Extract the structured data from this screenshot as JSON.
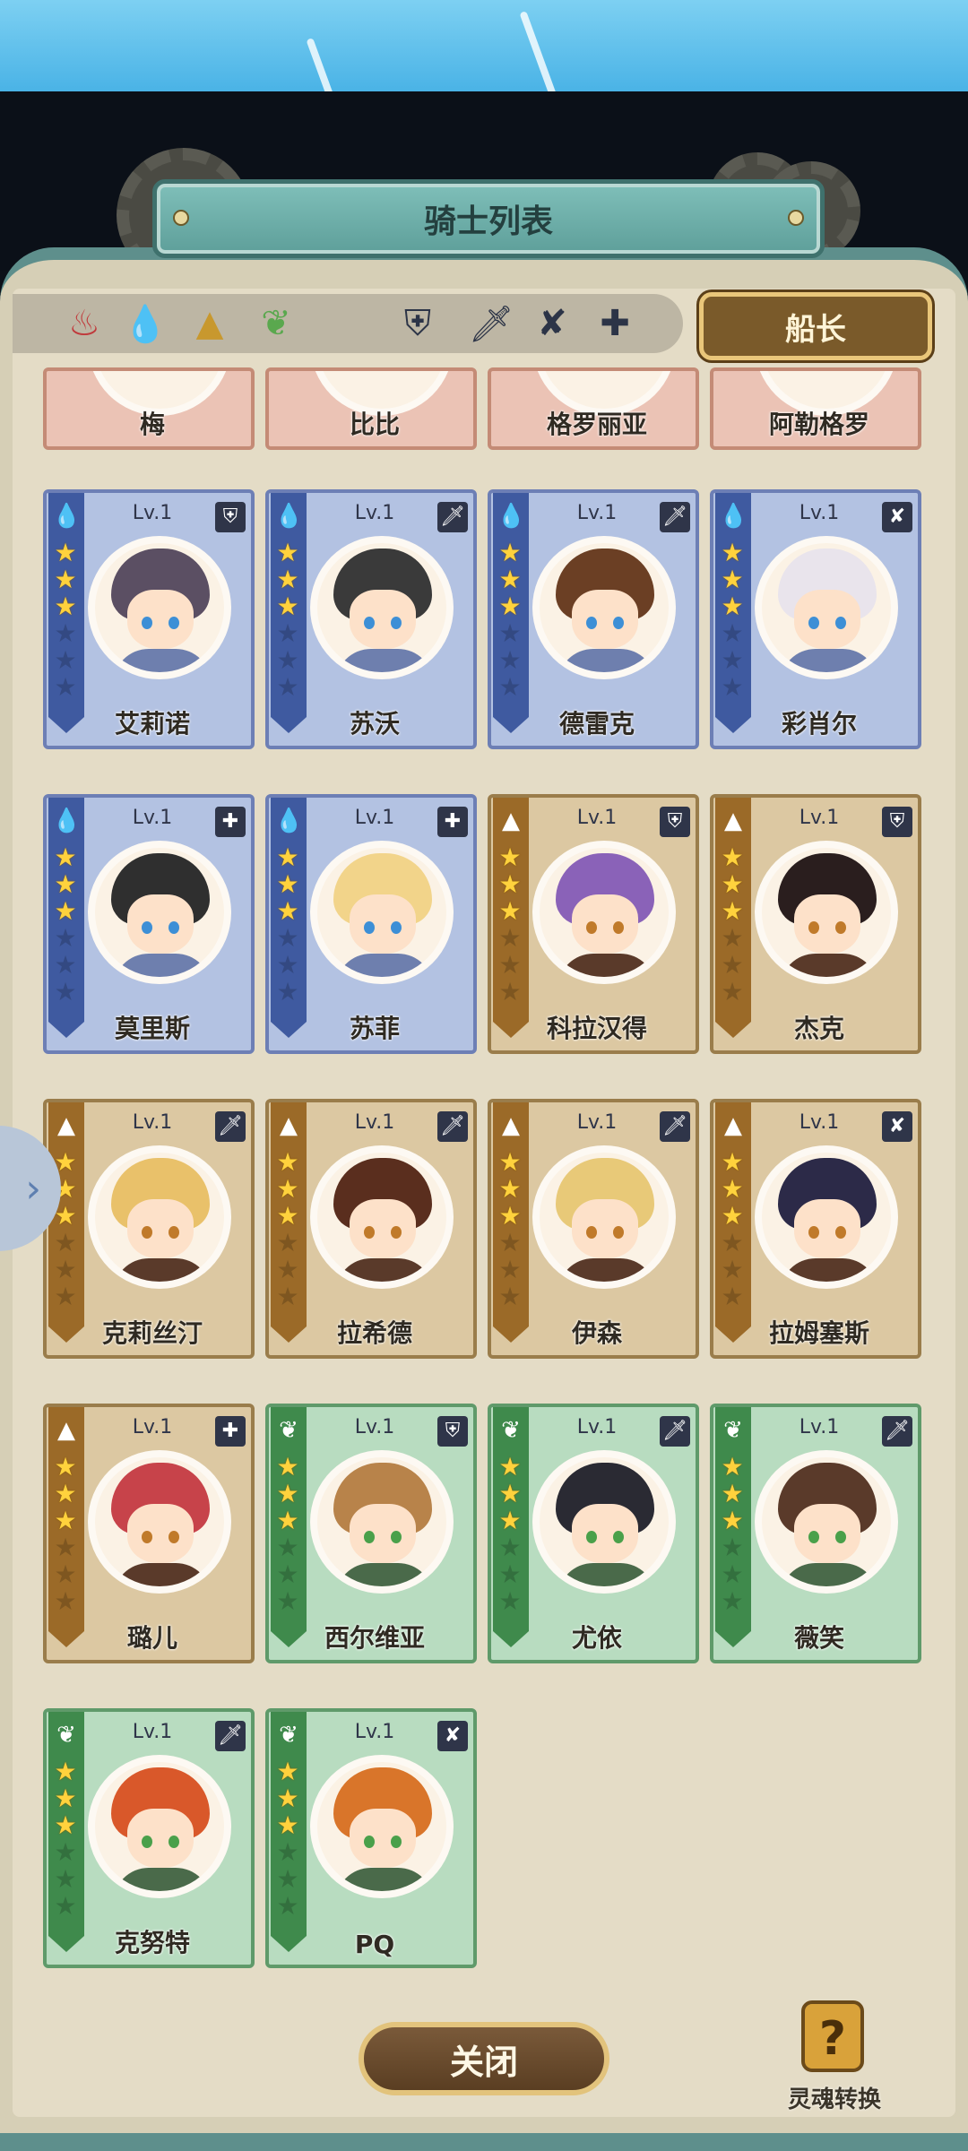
{
  "title": "骑士列表",
  "captain_label": "船长",
  "close_label": "关闭",
  "soul_label": "灵魂转换",
  "soul_icon_glyph": "?",
  "side_arrow_glyph": "›",
  "filters": {
    "elements": [
      {
        "name": "fire",
        "glyph": "♨"
      },
      {
        "name": "water",
        "glyph": "💧"
      },
      {
        "name": "earth",
        "glyph": "▲"
      },
      {
        "name": "wind",
        "glyph": "❦"
      }
    ],
    "classes": [
      {
        "name": "shield",
        "glyph": "⛨"
      },
      {
        "name": "sword",
        "glyph": "🗡"
      },
      {
        "name": "bow",
        "glyph": "✘"
      },
      {
        "name": "cross",
        "glyph": "✚"
      }
    ]
  },
  "partial_row": [
    {
      "name": "梅"
    },
    {
      "name": "比比"
    },
    {
      "name": "格罗丽亚"
    },
    {
      "name": "阿勒格罗"
    }
  ],
  "knights": [
    {
      "name": "艾莉诺",
      "level": "Lv.1",
      "element": "water",
      "class": "shield",
      "stars": 3
    },
    {
      "name": "苏沃",
      "level": "Lv.1",
      "element": "water",
      "class": "sword",
      "stars": 3
    },
    {
      "name": "德雷克",
      "level": "Lv.1",
      "element": "water",
      "class": "sword",
      "stars": 3
    },
    {
      "name": "彩肖尔",
      "level": "Lv.1",
      "element": "water",
      "class": "bow",
      "stars": 3
    },
    {
      "name": "莫里斯",
      "level": "Lv.1",
      "element": "water",
      "class": "cross",
      "stars": 3
    },
    {
      "name": "苏菲",
      "level": "Lv.1",
      "element": "water",
      "class": "cross",
      "stars": 3
    },
    {
      "name": "科拉汉得",
      "level": "Lv.1",
      "element": "earth",
      "class": "shield",
      "stars": 3
    },
    {
      "name": "杰克",
      "level": "Lv.1",
      "element": "earth",
      "class": "shield",
      "stars": 3
    },
    {
      "name": "克莉丝汀",
      "level": "Lv.1",
      "element": "earth",
      "class": "sword",
      "stars": 3
    },
    {
      "name": "拉希德",
      "level": "Lv.1",
      "element": "earth",
      "class": "sword",
      "stars": 3
    },
    {
      "name": "伊森",
      "level": "Lv.1",
      "element": "earth",
      "class": "sword",
      "stars": 3
    },
    {
      "name": "拉姆塞斯",
      "level": "Lv.1",
      "element": "earth",
      "class": "bow",
      "stars": 3
    },
    {
      "name": "璐儿",
      "level": "Lv.1",
      "element": "earth",
      "class": "cross",
      "stars": 3
    },
    {
      "name": "西尔维亚",
      "level": "Lv.1",
      "element": "wind",
      "class": "shield",
      "stars": 3
    },
    {
      "name": "尤依",
      "level": "Lv.1",
      "element": "wind",
      "class": "sword",
      "stars": 3
    },
    {
      "name": "薇笑",
      "level": "Lv.1",
      "element": "wind",
      "class": "sword",
      "stars": 3
    },
    {
      "name": "克努特",
      "level": "Lv.1",
      "element": "wind",
      "class": "sword",
      "stars": 3
    },
    {
      "name": "PQ",
      "level": "Lv.1",
      "element": "wind",
      "class": "bow",
      "stars": 3
    }
  ],
  "element_glyphs": {
    "water": "💧",
    "earth": "▲",
    "wind": "❦",
    "fire": "♨"
  },
  "class_glyphs": {
    "shield": "⛨",
    "sword": "🗡",
    "bow": "✘",
    "cross": "✚"
  },
  "colors": {
    "panel_teal": "#5e8f8c",
    "captain_gold": "#e9c67a",
    "water": "#3f5aa0",
    "earth": "#9b6a28",
    "wind": "#3f8a4c",
    "fire": "#c24a3e",
    "star": "#ffd23d"
  }
}
